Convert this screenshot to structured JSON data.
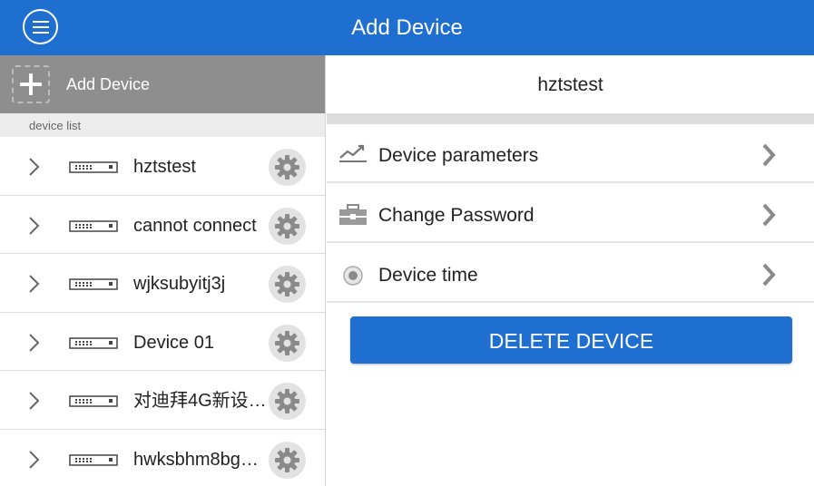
{
  "header": {
    "title": "Add Device",
    "menu_icon": "menu-icon"
  },
  "sidebar": {
    "add_label": "Add Device",
    "list_title": "device list",
    "devices": [
      {
        "name": "hztstest"
      },
      {
        "name": "cannot connect"
      },
      {
        "name": "wjksubyitj3j"
      },
      {
        "name": "Device 01"
      },
      {
        "name": "对迪拜4G新设…"
      },
      {
        "name": "hwksbhm8bg…"
      }
    ]
  },
  "detail": {
    "title": "hztstest",
    "options": [
      {
        "label": "Device parameters",
        "icon": "chart-line-icon"
      },
      {
        "label": "Change Password",
        "icon": "toolbox-icon"
      },
      {
        "label": "Device time",
        "icon": "clock-icon"
      }
    ],
    "delete_label": "DELETE DEVICE"
  },
  "colors": {
    "primary": "#1f6fd1",
    "add_bar": "#8e8e8e",
    "divider": "#dcdcdc"
  }
}
